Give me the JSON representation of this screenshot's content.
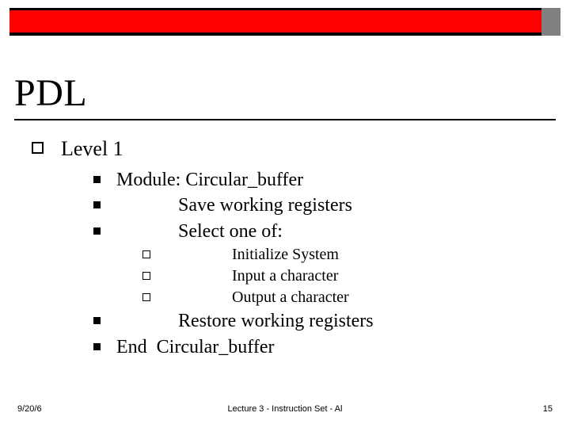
{
  "title": "PDL",
  "level1": {
    "label": "Level 1",
    "items": [
      "Module: Circular_buffer",
      "             Save working registers",
      "             Select one of:"
    ],
    "subitems": [
      "                 Initialize System",
      "                 Input a character",
      "                 Output a character"
    ],
    "items_after": [
      "             Restore working registers",
      "End  Circular_buffer"
    ]
  },
  "footer": {
    "date": "9/20/6",
    "lecture": "Lecture 3 - Instruction Set - Al",
    "page": "15"
  }
}
